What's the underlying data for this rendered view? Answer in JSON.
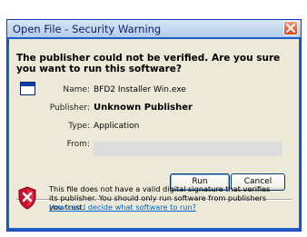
{
  "window": {
    "title": "Open File - Security Warning"
  },
  "dialog": {
    "question": "The publisher could not be verified.  Are you sure you want to run this software?",
    "fields": {
      "name_label": "Name:",
      "name_value": "BFD2 Installer Win.exe",
      "publisher_label": "Publisher:",
      "publisher_value": "Unknown Publisher",
      "type_label": "Type:",
      "type_value": "Application",
      "from_label": "From:",
      "from_value": ""
    },
    "buttons": {
      "run": "Run",
      "cancel": "Cancel"
    },
    "warning_text": "This file does not have a valid digital signature that verifies its publisher.  You should only run software from publishers you trust.",
    "help_link": "How can I decide what software to run?"
  },
  "colors": {
    "title_text": "#0a246a",
    "frame": "#1e5ec6",
    "client_bg": "#ece9d8",
    "close_button": "#d9431b",
    "link": "#0066cc",
    "shield": "#c8102e"
  },
  "icons": {
    "close": "close-icon",
    "application": "application-window-icon",
    "shield": "security-shield-icon"
  }
}
